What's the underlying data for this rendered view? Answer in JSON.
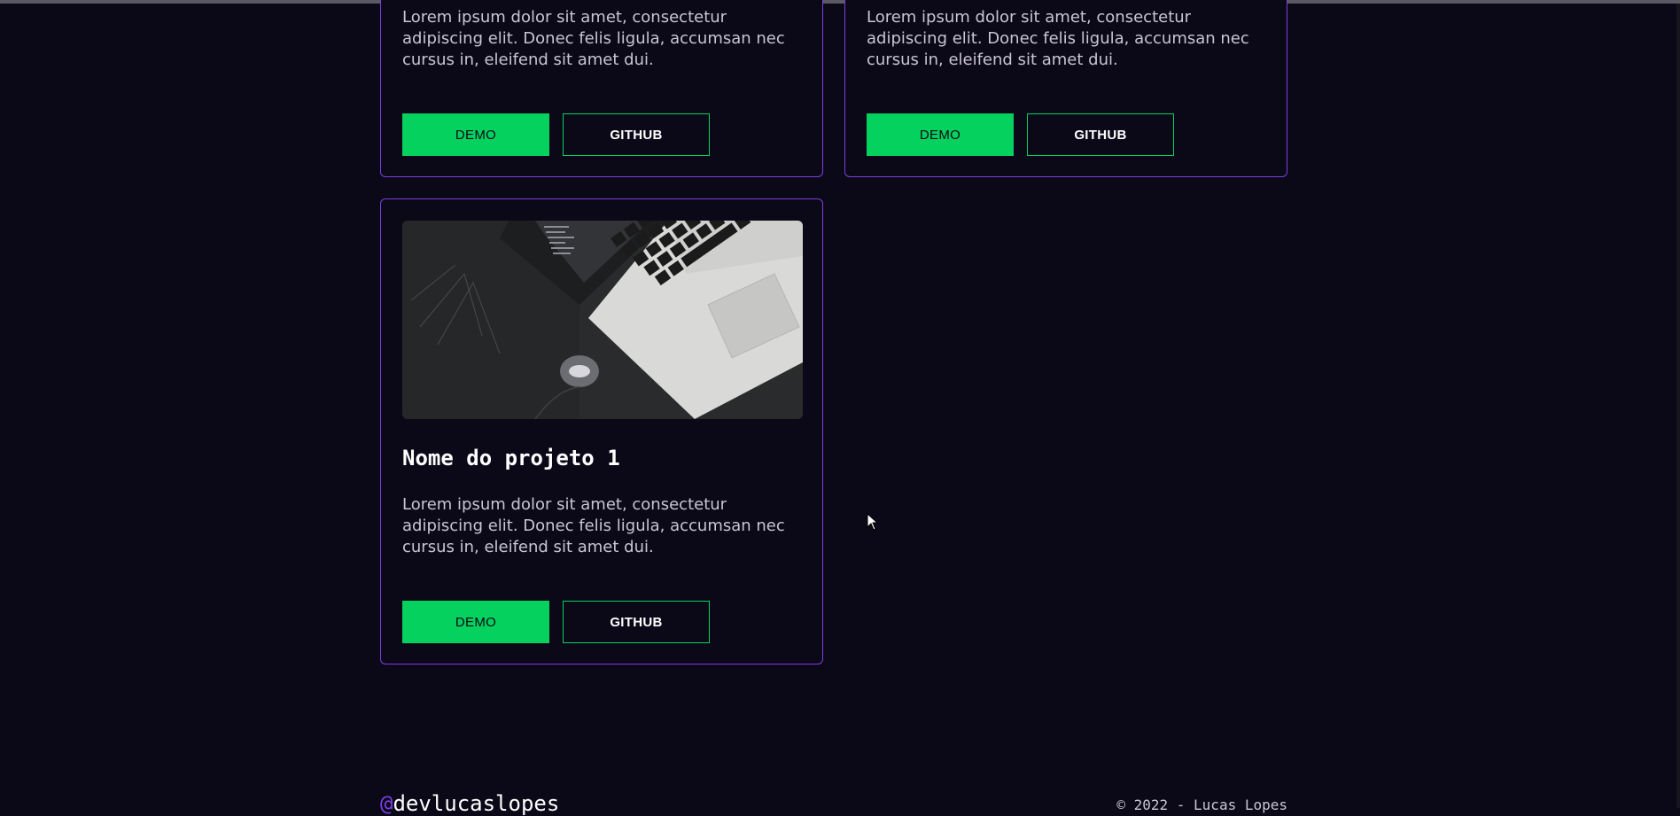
{
  "projects": [
    {
      "description": "Lorem ipsum dolor sit amet, consectetur adipiscing elit. Donec felis ligula, accumsan nec cursus in, eleifend sit amet dui.",
      "demo_label": "DEMO",
      "github_label": "GITHUB"
    },
    {
      "description": "Lorem ipsum dolor sit amet, consectetur adipiscing elit. Donec felis ligula, accumsan nec cursus in, eleifend sit amet dui.",
      "demo_label": "DEMO",
      "github_label": "GITHUB"
    },
    {
      "title": "Nome do projeto 1",
      "description": "Lorem ipsum dolor sit amet, consectetur adipiscing elit. Donec felis ligula, accumsan nec cursus in, eleifend sit amet dui.",
      "demo_label": "DEMO",
      "github_label": "GITHUB",
      "image_icon": "laptop-photo"
    }
  ],
  "footer": {
    "handle_prefix": "@",
    "handle": "devlucaslopes",
    "copyright": "© 2022 - Lucas Lopes"
  },
  "colors": {
    "background": "#0b0818",
    "card_border": "#7b3fe4",
    "accent_green": "#05d15f",
    "text_muted": "#c9c5d2"
  }
}
